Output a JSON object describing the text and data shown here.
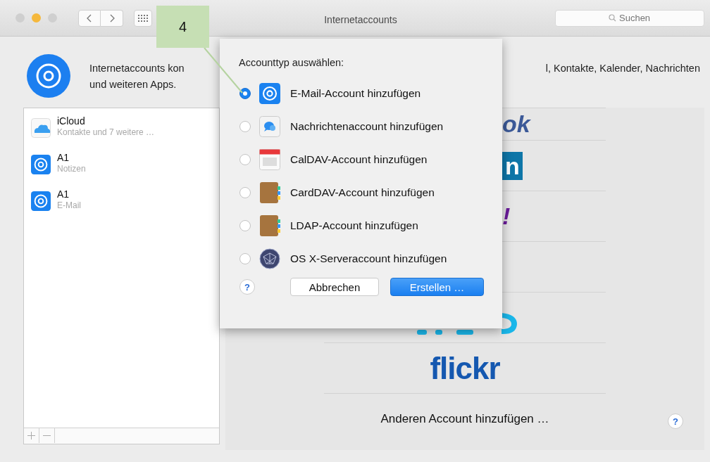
{
  "window": {
    "title": "Internetaccounts",
    "search": {
      "placeholder": "Suchen"
    }
  },
  "header": {
    "text_left": [
      "Internetaccounts kon",
      "und weiteren Apps."
    ],
    "text_right": "l, Kontakte, Kalender, Nachrichten"
  },
  "accounts": [
    {
      "name": "iCloud",
      "detail": "Kontakte und 7 weitere …",
      "kind": "cloud"
    },
    {
      "name": "A1",
      "detail": "Notizen",
      "kind": "at"
    },
    {
      "name": "A1",
      "detail": "E-Mail",
      "kind": "at"
    }
  ],
  "providers": [
    {
      "kind": "wordmark",
      "text": "ok",
      "color": "#3b5998"
    },
    {
      "kind": "boxed",
      "text": "n",
      "color": "#0e76a8"
    },
    {
      "kind": "wordmark",
      "text": "!",
      "color": "#6a1b9a"
    },
    {
      "kind": "empty"
    },
    {
      "kind": "fragment"
    },
    {
      "kind": "centered",
      "text": "flickr",
      "color": "#1558b0"
    }
  ],
  "other_account": "Anderen Account hinzufügen …",
  "help": "?",
  "sheet": {
    "title": "Accounttyp auswählen:",
    "help": "?",
    "options": [
      {
        "label": "E-Mail-Account hinzufügen",
        "kind": "mail",
        "selected": true
      },
      {
        "label": "Nachrichtenaccount hinzufügen",
        "kind": "messages",
        "selected": false
      },
      {
        "label": "CalDAV-Account hinzufügen",
        "kind": "calendar",
        "selected": false
      },
      {
        "label": "CardDAV-Account hinzufügen",
        "kind": "contacts",
        "selected": false
      },
      {
        "label": "LDAP-Account hinzufügen",
        "kind": "contacts",
        "selected": false
      },
      {
        "label": "OS X-Serveraccount hinzufügen",
        "kind": "server",
        "selected": false
      }
    ],
    "buttons": [
      {
        "label": "Abbrechen",
        "kind": "cancel"
      },
      {
        "label": "Erstellen …",
        "kind": "default"
      }
    ]
  },
  "callout": "4"
}
